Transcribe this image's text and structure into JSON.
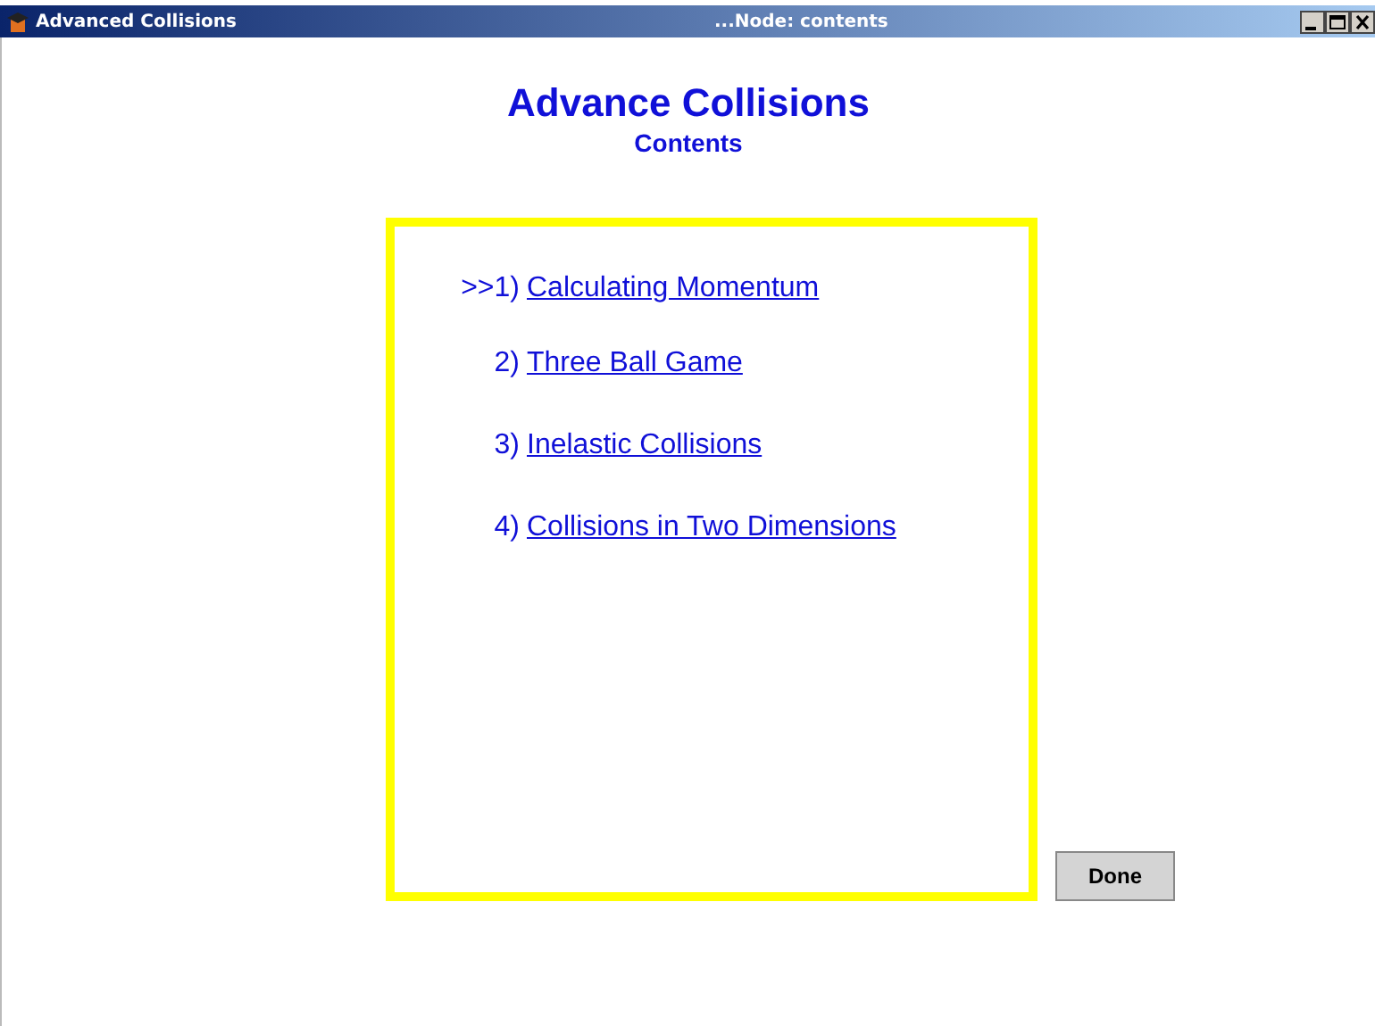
{
  "window": {
    "title": "Advanced Collisions",
    "node_title": "...Node: contents"
  },
  "heading": "Advance Collisions",
  "subheading": "Contents",
  "current_marker": ">>",
  "items": [
    {
      "number": "1)",
      "title": "Calculating Momentum",
      "current": true
    },
    {
      "number": "2)",
      "title": "Three Ball Game",
      "current": false
    },
    {
      "number": "3)",
      "title": "Inelastic Collisions",
      "current": false
    },
    {
      "number": "4)",
      "title": "Collisions in Two Dimensions",
      "current": false
    }
  ],
  "done_button": "Done"
}
